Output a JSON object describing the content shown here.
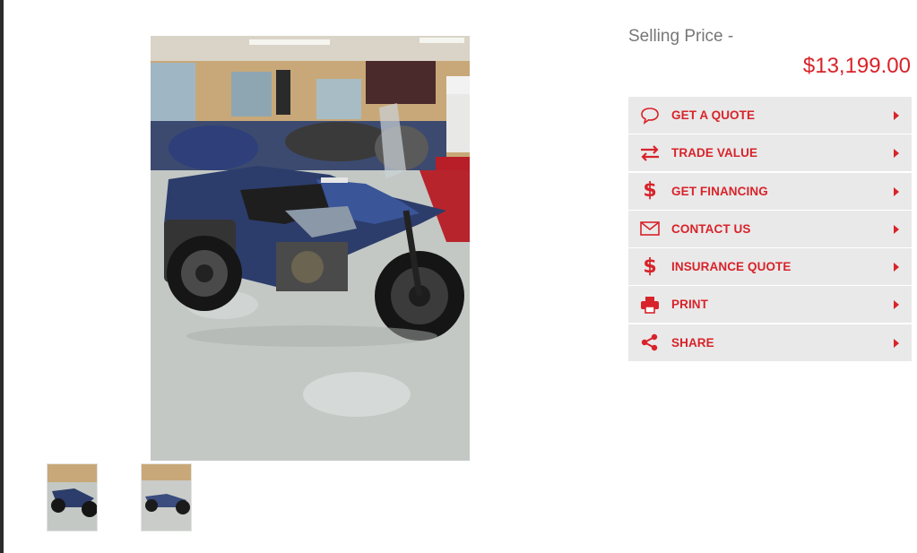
{
  "pricing": {
    "label": "Selling Price -",
    "value": "$13,199.00"
  },
  "actions": [
    {
      "label": "GET A QUOTE",
      "icon": "chat-bubble-icon"
    },
    {
      "label": "TRADE VALUE",
      "icon": "swap-arrows-icon"
    },
    {
      "label": "GET FINANCING",
      "icon": "dollar-icon"
    },
    {
      "label": "CONTACT US",
      "icon": "envelope-icon"
    },
    {
      "label": "INSURANCE QUOTE",
      "icon": "dollar-icon"
    },
    {
      "label": "PRINT",
      "icon": "printer-icon"
    },
    {
      "label": "SHARE",
      "icon": "share-icon"
    }
  ],
  "gallery": {
    "main_image": "motorcycle-photo",
    "thumbnail_count": 2
  },
  "colors": {
    "accent": "#d8232a",
    "button_bg": "#e9e9e9",
    "label_gray": "#777777"
  }
}
